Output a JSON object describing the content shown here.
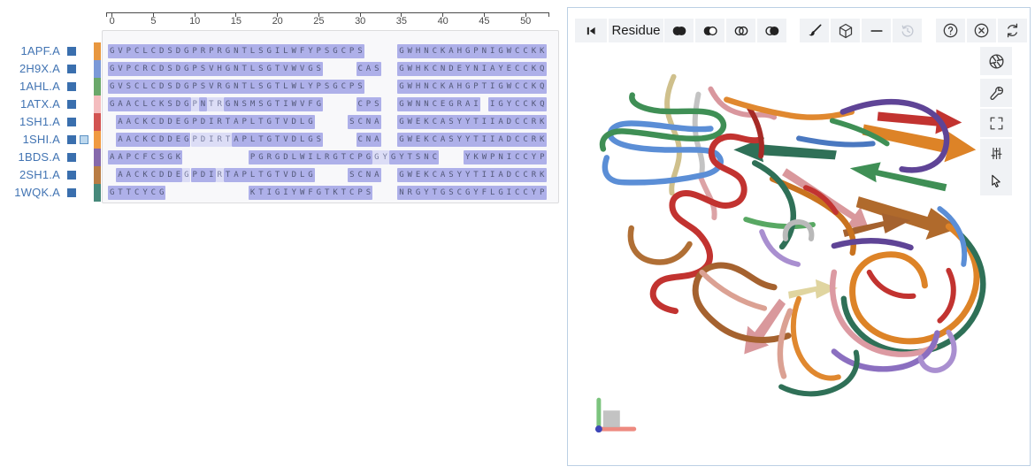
{
  "alignment": {
    "ruler": {
      "tick_labels": [
        "0",
        "5",
        "10",
        "15",
        "20",
        "25",
        "30",
        "35",
        "40",
        "45",
        "50"
      ]
    },
    "legend": {
      "dark_highlight": "#aeb0e9",
      "light_highlight": "#dcddf6"
    },
    "rows": [
      {
        "label": "1APF.A",
        "color": "#e8973f",
        "marker": false,
        "segments": [
          {
            "start": 0,
            "text": "GVPCLCDSDGPRPRGNTLSGILWFYPSGCPS",
            "shade": "d"
          },
          {
            "start": 35,
            "text": "GWHNCKAHGPNIGWCCKK",
            "shade": "d"
          }
        ]
      },
      {
        "label": "2H9X.A",
        "color": "#7b99d8",
        "marker": false,
        "segments": [
          {
            "start": 0,
            "text": "GVPCRCDSDGPSVHGNTLSGTVWVGS",
            "shade": "d"
          },
          {
            "start": 30,
            "text": "CAS",
            "shade": "d"
          },
          {
            "start": 35,
            "text": "GWHKCNDEYNIAYECCKQ",
            "shade": "d"
          }
        ]
      },
      {
        "label": "1AHL.A",
        "color": "#6aa86a",
        "marker": false,
        "segments": [
          {
            "start": 0,
            "text": "GVSCLCDSDGPSVRGNTLSGTLWLYPSGCPS",
            "shade": "d"
          },
          {
            "start": 35,
            "text": "GWHNCKAHGPTIGWCCKQ",
            "shade": "d"
          }
        ]
      },
      {
        "label": "1ATX.A",
        "color": "#f4bcbe",
        "marker": false,
        "segments": [
          {
            "start": 0,
            "text": "GAACLCKSDG",
            "shade": "d"
          },
          {
            "start": 10,
            "text": "P",
            "shade": "l"
          },
          {
            "start": 11,
            "text": "N",
            "shade": "d"
          },
          {
            "start": 12,
            "text": "TR",
            "shade": "l"
          },
          {
            "start": 14,
            "text": "GNSMSGTIWVFG",
            "shade": "d"
          },
          {
            "start": 30,
            "text": "CPS",
            "shade": "d"
          },
          {
            "start": 35,
            "text": "GWNNCEGRAI",
            "shade": "d"
          },
          {
            "start": 46,
            "text": "IGYCCKQ",
            "shade": "d"
          }
        ]
      },
      {
        "label": "1SH1.A",
        "color": "#d25351",
        "marker": false,
        "segments": [
          {
            "start": 1,
            "text": "AACKCDDEGPDIRTAPLTGTVDLG",
            "shade": "d"
          },
          {
            "start": 29,
            "text": "SCNA",
            "shade": "d"
          },
          {
            "start": 35,
            "text": "GWEKCASYYTIIADCCRK",
            "shade": "d"
          }
        ]
      },
      {
        "label": "1SHI.A",
        "color": "#f09a41",
        "marker": true,
        "segments": [
          {
            "start": 1,
            "text": "AACKCDDEG",
            "shade": "d"
          },
          {
            "start": 10,
            "text": "PDIRT",
            "shade": "l"
          },
          {
            "start": 15,
            "text": "APLTGTVDLGS",
            "shade": "d"
          },
          {
            "start": 30,
            "text": "CNA",
            "shade": "d"
          },
          {
            "start": 35,
            "text": "GWEKCASYYTIIADCCRK",
            "shade": "d"
          }
        ]
      },
      {
        "label": "1BDS.A",
        "color": "#8669ab",
        "marker": false,
        "segments": [
          {
            "start": 0,
            "text": "AAPCFCSGK",
            "shade": "d"
          },
          {
            "start": 17,
            "text": "PGRGDLWILRGTCPG",
            "shade": "d"
          },
          {
            "start": 32,
            "text": "GY",
            "shade": "l"
          },
          {
            "start": 34,
            "text": "GYTSNC",
            "shade": "d"
          },
          {
            "start": 43,
            "text": "YKWPNICCYP",
            "shade": "d"
          }
        ]
      },
      {
        "label": "2SH1.A",
        "color": "#b97c44",
        "marker": false,
        "segments": [
          {
            "start": 1,
            "text": "AACKCDDE",
            "shade": "d"
          },
          {
            "start": 9,
            "text": "G",
            "shade": "l"
          },
          {
            "start": 10,
            "text": "PDI",
            "shade": "d"
          },
          {
            "start": 13,
            "text": "R",
            "shade": "l"
          },
          {
            "start": 14,
            "text": "TAPLTGTVDLG",
            "shade": "d"
          },
          {
            "start": 29,
            "text": "SCNA",
            "shade": "d"
          },
          {
            "start": 35,
            "text": "GWEKCASYYTIIADCCRK",
            "shade": "d"
          }
        ]
      },
      {
        "label": "1WQK.A",
        "color": "#47897b",
        "marker": false,
        "segments": [
          {
            "start": 0,
            "text": "GTTCYCG",
            "shade": "d"
          },
          {
            "start": 17,
            "text": "KTIGIYWFGTKTCPS",
            "shade": "d"
          },
          {
            "start": 35,
            "text": "NRGYTGSCGYFLGICCYP",
            "shade": "d"
          }
        ]
      }
    ]
  },
  "viewer": {
    "toolbar": {
      "granularity_label": "Residue",
      "icons": [
        "first-icon",
        "union-icon",
        "subtract-icon",
        "intersect-icon",
        "set-icon",
        "brush-icon",
        "cube-icon",
        "minus-icon",
        "history-icon",
        "help-icon",
        "close-icon",
        "refresh-icon"
      ],
      "history_disabled": true
    },
    "sidebar_icons": [
      "screenshot-icon",
      "tools-icon",
      "expand-icon",
      "settings-icon",
      "cursor-icon"
    ],
    "axes_widget": {
      "x_color": "#ee8a80",
      "y_color": "#7cc47e",
      "z_color": "#3d46b8"
    }
  },
  "colors": {
    "accent_blue": "#4274b3",
    "row_square": "#3a6fae",
    "selected_marker_fill": "#bdd8ee",
    "selected_marker_border": "#5d92c4",
    "panel_border": "#bcd0e4",
    "toolbar_button_bg": "#f0f2f5"
  }
}
